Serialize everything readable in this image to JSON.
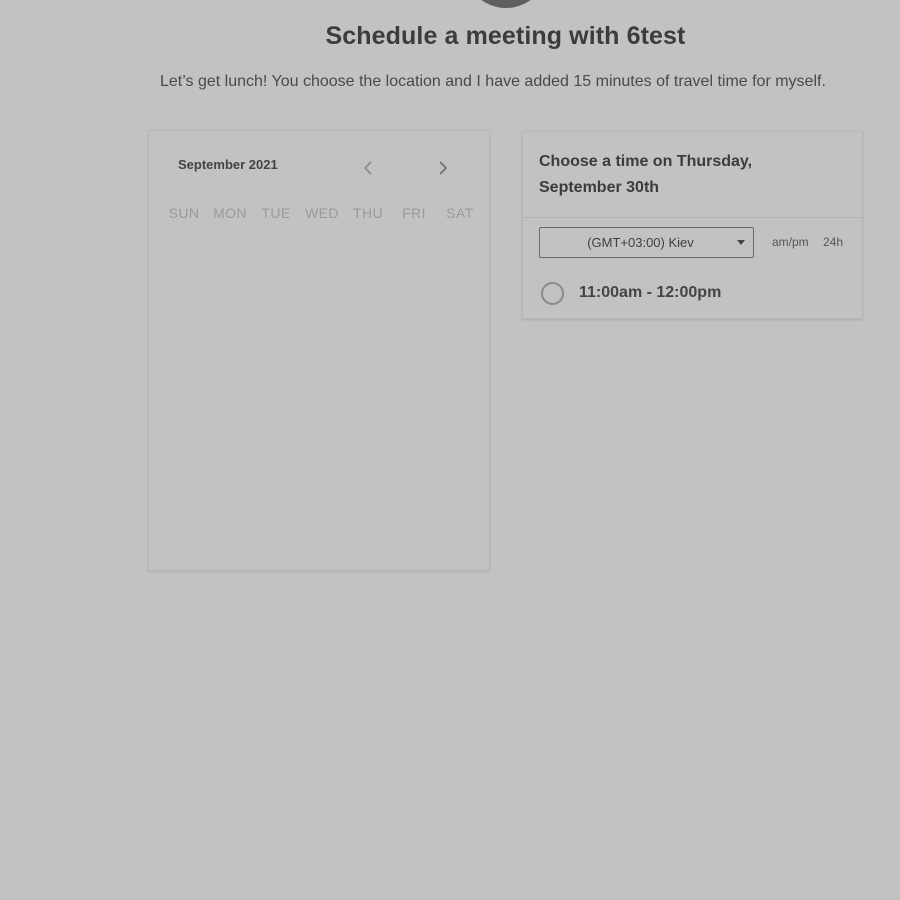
{
  "header": {
    "title": "Schedule a meeting with 6test",
    "description": "Let’s get lunch! You choose the location and I have added 15 minutes of travel time for myself."
  },
  "calendar": {
    "month_label": "September 2021",
    "prev_icon": "chevron-left-icon",
    "next_icon": "chevron-right-icon",
    "weekdays": [
      "SUN",
      "MON",
      "TUE",
      "WED",
      "THU",
      "FRI",
      "SAT"
    ]
  },
  "time_picker": {
    "heading": "Choose a time on Thursday, September 30th",
    "timezone": "(GMT+03:00) Kiev",
    "caret_icon": "caret-down-icon",
    "format_ampm": "am/pm",
    "format_24h": "24h",
    "slots": [
      {
        "label": "11:00am - 12:00pm",
        "selected": false
      }
    ]
  },
  "colors": {
    "background": "#c2c2c2",
    "avatar": "#5e5e5e",
    "text": "#3c3c3c",
    "muted": "#9a9a9a"
  }
}
